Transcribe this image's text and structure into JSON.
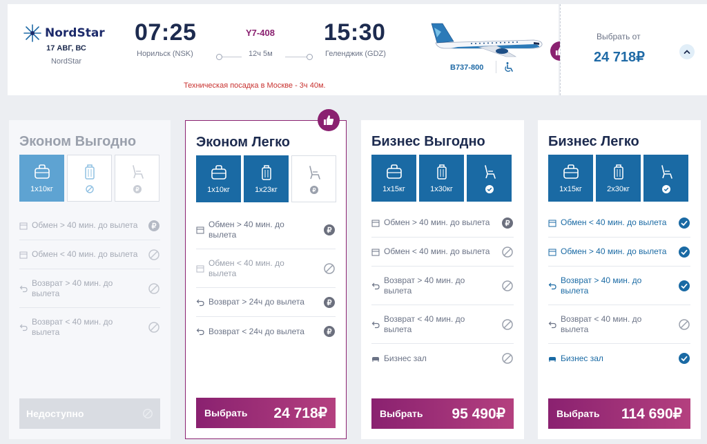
{
  "flight": {
    "airline_logo": "NordStar",
    "date": "17 АВГ, ВС",
    "airline": "NordStar",
    "departure_time": "07:25",
    "departure_city": "Норильск (NSK)",
    "flight_number": "Y7-408",
    "duration": "12ч 5м",
    "arrival_time": "15:30",
    "arrival_city": "Геленджик (GDZ)",
    "aircraft": "B737-800",
    "notice": "Техническая посадка в Москве - 3ч 40м."
  },
  "price_panel": {
    "label": "Выбрать от",
    "price": "24 718₽"
  },
  "colors": {
    "brand_purple": "#8a2170",
    "brand_blue": "#1a6aa4",
    "notice_red": "#c8312f"
  },
  "tariffs": [
    {
      "title": "Эконом Выгодно",
      "state": "unavailable",
      "bags": [
        {
          "label": "1x10кг",
          "on": true,
          "icon": "handbag-icon"
        },
        {
          "label": "",
          "on": false,
          "icon": "suitcase-icon",
          "status": "not-included"
        },
        {
          "label": "",
          "on": false,
          "icon": "seat-icon",
          "status": "paid"
        }
      ],
      "options": [
        {
          "text": "Обмен > 40 мин. до вылета",
          "icon": "calendar-icon",
          "status": "paid"
        },
        {
          "text": "Обмен < 40 мин. до вылета",
          "icon": "calendar-icon",
          "status": "not-included"
        },
        {
          "text": "Возврат > 40 мин. до вылета",
          "icon": "return-icon",
          "status": "not-included"
        },
        {
          "text": "Возврат < 40 мин. до вылета",
          "icon": "return-icon",
          "status": "not-included"
        }
      ],
      "button_label": "Недоступно",
      "button_price": ""
    },
    {
      "title": "Эконом Легко",
      "state": "recommended",
      "bags": [
        {
          "label": "1x10кг",
          "on": true,
          "icon": "handbag-icon"
        },
        {
          "label": "1x23кг",
          "on": true,
          "icon": "suitcase-icon"
        },
        {
          "label": "",
          "on": false,
          "icon": "seat-icon",
          "status": "paid"
        }
      ],
      "options": [
        {
          "text": "Обмен > 40 мин. до вылета",
          "icon": "calendar-icon",
          "status": "paid"
        },
        {
          "text": "Обмен < 40 мин. до вылета",
          "icon": "calendar-icon",
          "status": "not-included"
        },
        {
          "text": "Возврат > 24ч до вылета",
          "icon": "return-icon",
          "status": "paid"
        },
        {
          "text": "Возврат < 24ч до вылета",
          "icon": "return-icon",
          "status": "paid"
        }
      ],
      "button_label": "Выбрать",
      "button_price": "24 718₽"
    },
    {
      "title": "Бизнес Выгодно",
      "state": "available",
      "bags": [
        {
          "label": "1x15кг",
          "on": true,
          "icon": "handbag-icon"
        },
        {
          "label": "1x30кг",
          "on": true,
          "icon": "suitcase-icon"
        },
        {
          "label": "",
          "on": true,
          "icon": "seat-icon",
          "status": "included"
        }
      ],
      "options": [
        {
          "text": "Обмен > 40 мин. до вылета",
          "icon": "calendar-icon",
          "status": "paid"
        },
        {
          "text": "Обмен < 40 мин. до вылета",
          "icon": "calendar-icon",
          "status": "not-included"
        },
        {
          "text": "Возврат > 40 мин. до вылета",
          "icon": "return-icon",
          "status": "not-included"
        },
        {
          "text": "Возврат < 40 мин. до вылета",
          "icon": "return-icon",
          "status": "not-included"
        },
        {
          "text": "Бизнес зал",
          "icon": "lounge-icon",
          "status": "not-included"
        }
      ],
      "button_label": "Выбрать",
      "button_price": "95 490₽"
    },
    {
      "title": "Бизнес Легко",
      "state": "available",
      "bags": [
        {
          "label": "1x15кг",
          "on": true,
          "icon": "handbag-icon"
        },
        {
          "label": "2x30кг",
          "on": true,
          "icon": "suitcase-icon"
        },
        {
          "label": "",
          "on": true,
          "icon": "seat-icon",
          "status": "included"
        }
      ],
      "options": [
        {
          "text": "Обмен < 40 мин. до вылета",
          "icon": "calendar-icon",
          "status": "included"
        },
        {
          "text": "Обмен > 40 мин. до вылета",
          "icon": "calendar-icon",
          "status": "included"
        },
        {
          "text": "Возврат > 40 мин. до вылета",
          "icon": "return-icon",
          "status": "included"
        },
        {
          "text": "Возврат < 40 мин. до вылета",
          "icon": "return-icon",
          "status": "not-included"
        },
        {
          "text": "Бизнес зал",
          "icon": "lounge-icon",
          "status": "included"
        }
      ],
      "button_label": "Выбрать",
      "button_price": "114 690₽"
    }
  ]
}
